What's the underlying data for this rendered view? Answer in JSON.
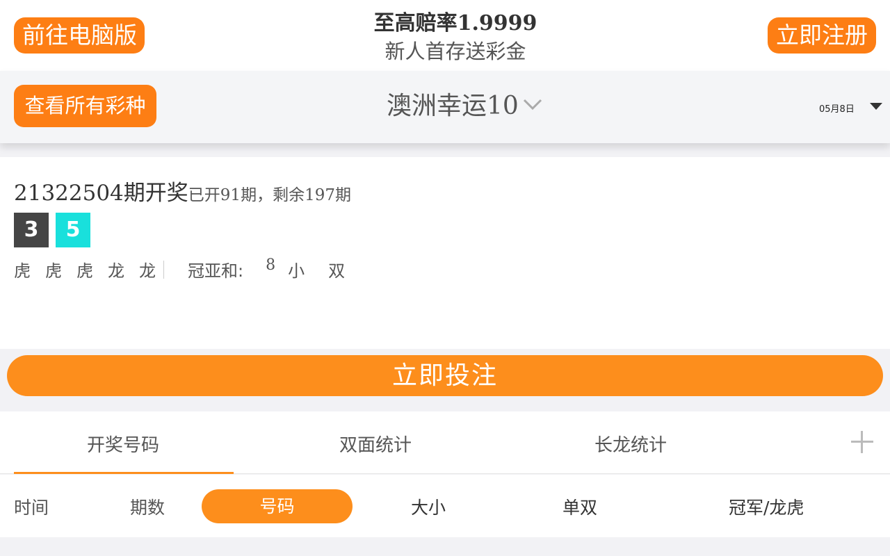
{
  "header": {
    "pc_button": "前往电脑版",
    "promo_title": "至高赔率1.9999",
    "promo_subtitle": "新人首存送彩金",
    "register_button": "立即注册"
  },
  "lottery_bar": {
    "all_lotteries_button": "查看所有彩种",
    "lottery_name": "澳洲幸运10",
    "date": "05月8日"
  },
  "result": {
    "issue_main": "21322504期开奖",
    "issue_rest": "已开91期，剩余197期",
    "balls": [
      {
        "value": "3",
        "color": "#454545"
      },
      {
        "value": "5",
        "color": "#19e0dc"
      }
    ],
    "dragon_tiger": [
      "虎",
      "虎",
      "虎",
      "龙",
      "龙"
    ],
    "sum_label": "冠亚和:",
    "sum_value": "8",
    "sum_size": "小",
    "sum_parity": "双"
  },
  "bet_button": "立即投注",
  "tabs": [
    "开奖号码",
    "双面统计",
    "长龙统计"
  ],
  "subtabs": {
    "time": "时间",
    "issue": "期数",
    "number": "号码",
    "size": "大小",
    "parity": "单双",
    "champion": "冠军/龙虎"
  },
  "colors": {
    "accent": "#fd8e1c"
  }
}
